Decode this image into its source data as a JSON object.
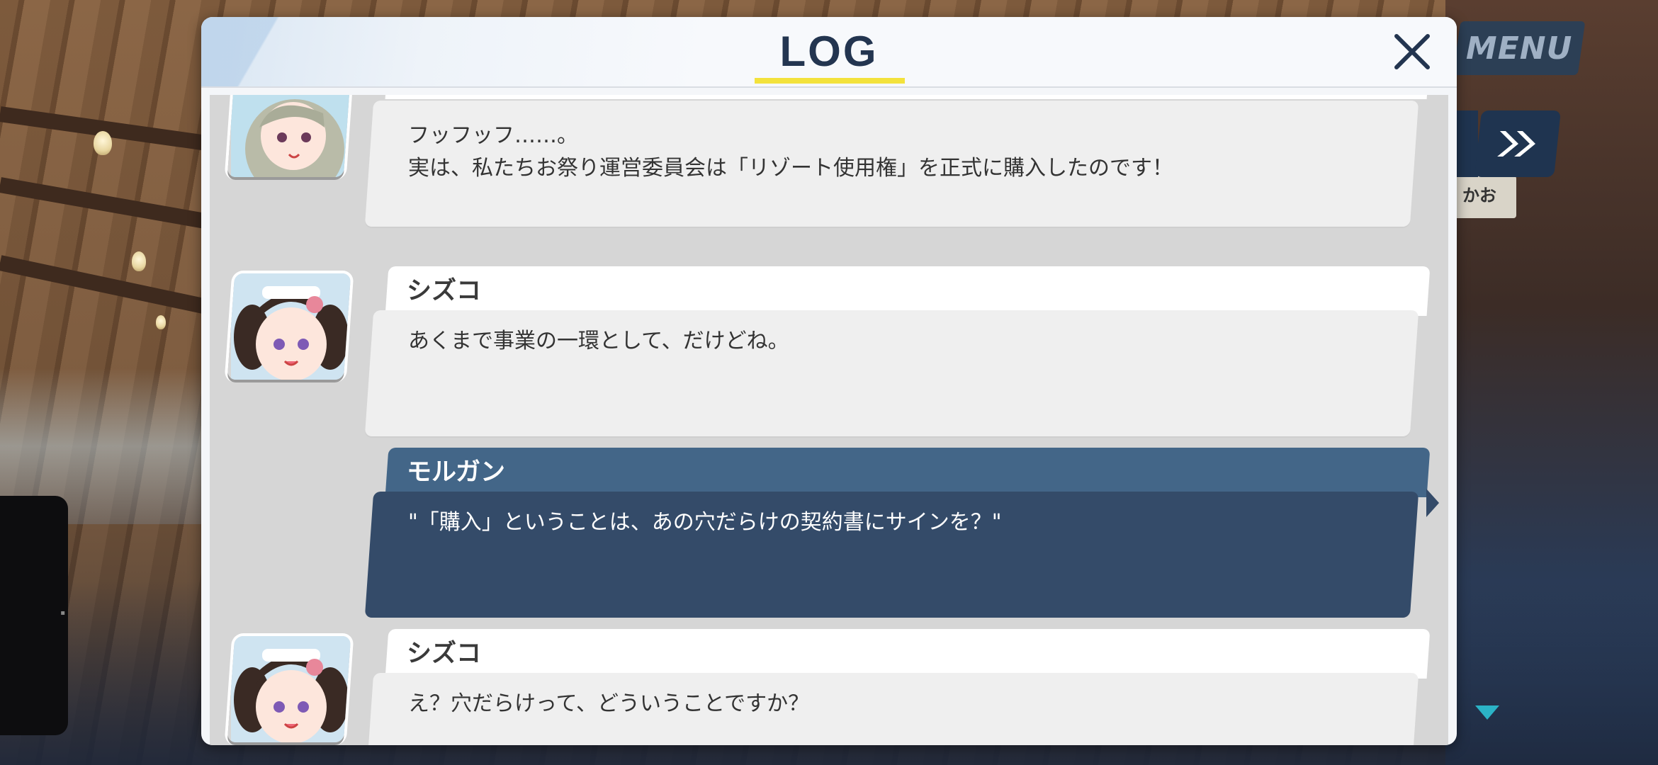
{
  "menu": {
    "label": "MENU"
  },
  "controls": {
    "fast_forward_icon": "double-chevron-right-icon",
    "scroll_down_icon": "triangle-down-icon"
  },
  "sign": {
    "text": "かお"
  },
  "log": {
    "title": "LOG",
    "close_icon": "close-icon",
    "entries": [
      {
        "speaker": "",
        "lines": [
          "フッフッフ……。",
          "実は、私たちお祭り運営委員会は「リゾート使用権」を正式に購入したのです！"
        ],
        "avatar_icon": "character-portrait-gray-hair",
        "active": false
      },
      {
        "speaker": "シズコ",
        "lines": [
          "あくまで事業の一環として、だけどね。"
        ],
        "avatar_icon": "character-portrait-shizuko",
        "active": false
      },
      {
        "speaker": "モルガン",
        "lines": [
          "\"「購入」ということは、あの穴だらけの契約書にサインを？\""
        ],
        "avatar_icon": "",
        "active": true
      },
      {
        "speaker": "シズコ",
        "lines": [
          "え？穴だらけって、どういうことですか？"
        ],
        "avatar_icon": "character-portrait-shizuko",
        "active": false
      }
    ]
  },
  "colors": {
    "accent_underline": "#f3e23c",
    "title_text": "#233550",
    "active_name_bg": "#436688",
    "active_text_bg": "#344b69",
    "scroll_arrow": "#2bb3c6"
  }
}
